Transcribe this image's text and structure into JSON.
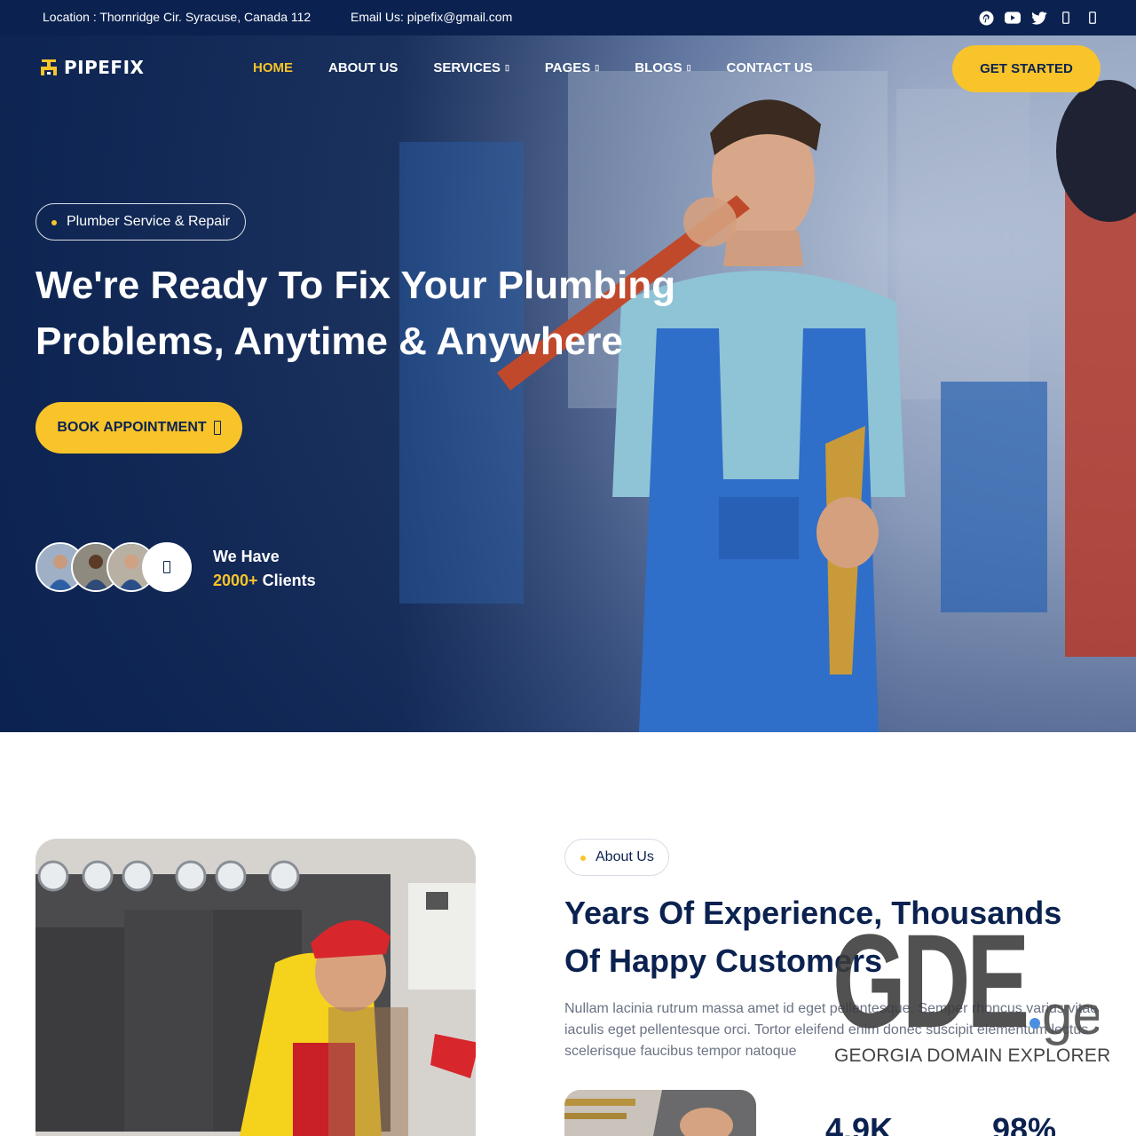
{
  "topbar": {
    "location": "Location : Thornridge Cir. Syracuse, Canada 112",
    "email": "Email Us: pipefix@gmail.com",
    "socials": [
      "pinterest-icon",
      "youtube-icon",
      "twitter-icon",
      "instagram-icon",
      "linkedin-icon"
    ]
  },
  "brand": {
    "name": "PIPEFIX"
  },
  "nav": {
    "home": "HOME",
    "about": "ABOUT US",
    "services": "SERVICES",
    "pages": "PAGES",
    "blogs": "BLOGS",
    "contact": "CONTACT US",
    "cta": "GET STARTED"
  },
  "hero": {
    "tag": "Plumber Service & Repair",
    "title_line1": "We're Ready To Fix Your Plumbing",
    "title_line2": "Problems, Anytime & Anywhere",
    "button": "BOOK APPOINTMENT",
    "clients_line1": "We Have",
    "clients_count": "2000+",
    "clients_suffix": "Clients"
  },
  "about": {
    "tag": "About Us",
    "title_line1": "Years Of Experience, Thousands",
    "title_line2": "Of Happy Customers",
    "text": "Nullam lacinia rutrum massa amet id eget pellentesque. Semper rhoncus varius vitae iaculis eget pellentesque orci. Tortor eleifend enim donec suscipit elementum lectus scelerisque faucibus tempor natoque",
    "stat1": "4.9K",
    "stat2": "98%"
  },
  "watermark": {
    "logo": "GDE.ge",
    "subtitle": "GEORGIA DOMAIN EXPLORER"
  },
  "colors": {
    "navy": "#0b2250",
    "accent": "#f8c42a"
  }
}
